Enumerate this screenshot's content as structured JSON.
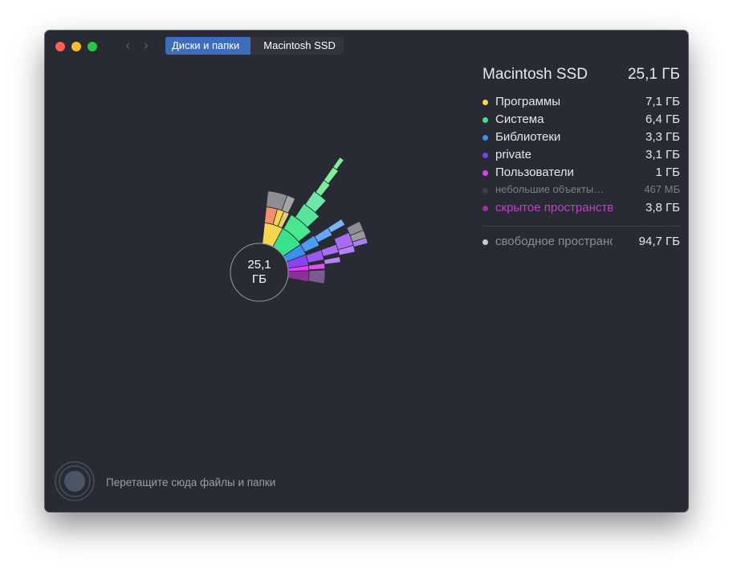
{
  "breadcrumb": {
    "items": [
      "Диски и папки",
      "Macintosh SSD"
    ]
  },
  "chart_center": {
    "value": "25,1",
    "unit": "ГБ"
  },
  "panel": {
    "title": "Macintosh SSD",
    "total": "25,1 ГБ",
    "items": [
      {
        "name": "Программы",
        "size": "7,1 ГБ",
        "color": "#f7d64a"
      },
      {
        "name": "Система",
        "size": "6,4 ГБ",
        "color": "#36e58c"
      },
      {
        "name": "Библиотеки",
        "size": "3,3 ГБ",
        "color": "#3d8ef0"
      },
      {
        "name": "private",
        "size": "3,1 ГБ",
        "color": "#7e3cf0"
      },
      {
        "name": "Пользователи",
        "size": "1    ГБ",
        "color": "#e13df0"
      }
    ],
    "small_objects": {
      "name": "небольшие объекты…",
      "size": "467    МБ",
      "color": "#3a3e46"
    },
    "hidden_space": {
      "name": "скрытое пространство",
      "size": "3,8 ГБ",
      "color": "#9b2fa3"
    },
    "free_space": {
      "name": "свободное пространство",
      "size": "94,7 ГБ",
      "color": "#c9cbcf"
    }
  },
  "drop_hint": "Перетащите сюда файлы и папки",
  "icons": [
    "chevron-left-icon",
    "chevron-right-icon",
    "drop-target-icon"
  ]
}
